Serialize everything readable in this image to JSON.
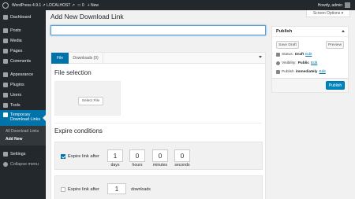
{
  "adminbar": {
    "site_name": "WordPress 4.9.1 ↗ LOCALHOST ↗",
    "comments_count": "0",
    "new_label": "+ New",
    "howdy": "Howdy, admin"
  },
  "sidebar": {
    "dashboard": "Dashboard",
    "posts": "Posts",
    "media": "Media",
    "pages": "Pages",
    "comments": "Comments",
    "appearance": "Appearance",
    "plugins": "Plugins",
    "users": "Users",
    "tools": "Tools",
    "temp_links": "Temporary Download Links",
    "sub_all": "All Download Links",
    "sub_add": "Add New",
    "settings": "Settings",
    "collapse": "Collapse menu"
  },
  "header": {
    "screen_options": "Screen Options ▾",
    "page_title": "Add New Download Link"
  },
  "title_input": {
    "value": "",
    "placeholder": ""
  },
  "tabs": [
    {
      "label": "File",
      "active": true
    },
    {
      "label": "Downloads (0)",
      "active": false
    }
  ],
  "file_section": {
    "heading": "File selection",
    "select_button": "Select File"
  },
  "expire": {
    "heading": "Expire conditions",
    "time_row": {
      "checked": true,
      "label": "Expire link after",
      "days": "1",
      "hours": "0",
      "minutes": "0",
      "seconds": "0",
      "unit_days": "days",
      "unit_hours": "hours",
      "unit_minutes": "minutes",
      "unit_seconds": "seconds"
    },
    "download_row": {
      "checked": false,
      "label": "Expire link after",
      "count": "1",
      "unit": "downloads"
    }
  },
  "publish": {
    "title": "Publish",
    "save_draft": "Save Draft",
    "preview": "Preview",
    "status_label": "Status:",
    "status_value": "Draft",
    "visibility_label": "Visibility:",
    "visibility_value": "Public",
    "publish_label": "Publish",
    "publish_value": "immediately",
    "edit": "Edit",
    "publish_button": "Publish"
  },
  "colors": {
    "accent": "#0073aa",
    "sidebar_bg": "#23282d",
    "primary_button": "#0085ba"
  }
}
